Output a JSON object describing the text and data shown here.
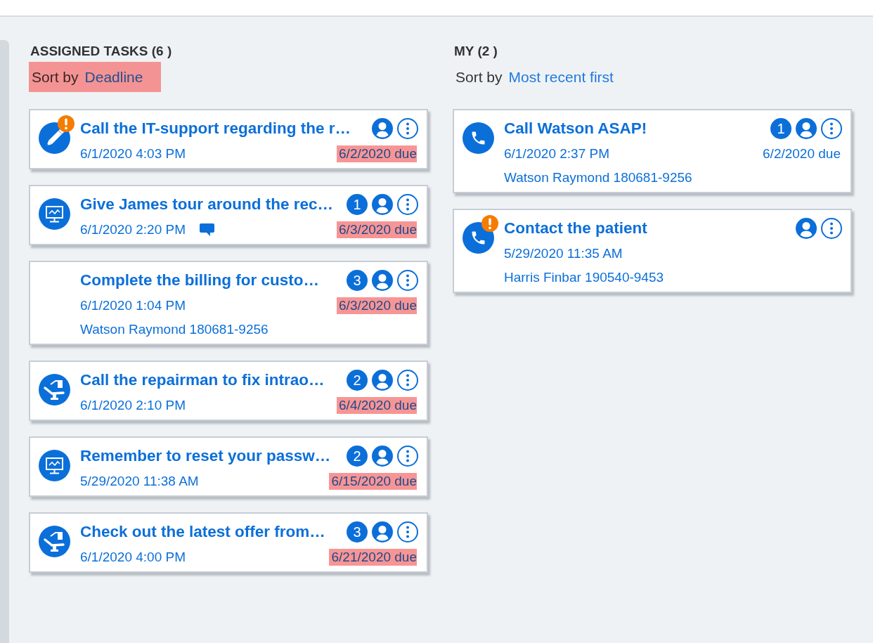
{
  "columns": [
    {
      "heading": "ASSIGNED TASKS (6 )",
      "sort": {
        "label": "Sort by",
        "value": "Deadline",
        "highlighted": true
      },
      "cards": [
        {
          "kind": "pencil",
          "alert": true,
          "title": "Call the IT-support regarding the r…",
          "created": "6/1/2020 4:03 PM",
          "comment": false,
          "due": {
            "text": "6/2/2020 due",
            "highlighted": true
          }
        },
        {
          "kind": "monitor",
          "alert": false,
          "title": "Give James tour around the rec…",
          "count": "1",
          "created": "6/1/2020 2:20 PM",
          "comment": true,
          "due": {
            "text": "6/3/2020 due",
            "highlighted": true
          }
        },
        {
          "kind": "blank",
          "alert": false,
          "title": "Complete the billing for custo…",
          "count": "3",
          "created": "6/1/2020 1:04 PM",
          "comment": false,
          "due": {
            "text": "6/3/2020 due",
            "highlighted": true
          },
          "contact": "Watson Raymond 180681-9256"
        },
        {
          "kind": "chair",
          "alert": false,
          "title": "Call the repairman to fix intrao…",
          "count": "2",
          "created": "6/1/2020 2:10 PM",
          "comment": false,
          "due": {
            "text": "6/4/2020 due",
            "highlighted": true
          }
        },
        {
          "kind": "monitor",
          "alert": false,
          "title": "Remember to reset your passw…",
          "count": "2",
          "created": "5/29/2020 11:38 AM",
          "comment": false,
          "due": {
            "text": "6/15/2020 due",
            "highlighted": true
          }
        },
        {
          "kind": "chair",
          "alert": false,
          "title": "Check out the latest offer from…",
          "count": "3",
          "created": "6/1/2020 4:00 PM",
          "comment": false,
          "due": {
            "text": "6/21/2020 due",
            "highlighted": true
          }
        }
      ]
    },
    {
      "heading": "MY (2 )",
      "sort": {
        "label": "Sort by",
        "value": "Most recent first",
        "highlighted": false
      },
      "cards": [
        {
          "kind": "phone",
          "alert": false,
          "title": "Call Watson ASAP!",
          "count": "1",
          "created": "6/1/2020 2:37 PM",
          "comment": false,
          "due": {
            "text": "6/2/2020 due",
            "highlighted": false
          },
          "contact": "Watson Raymond 180681-9256"
        },
        {
          "kind": "phone",
          "alert": true,
          "title": "Contact the patient",
          "created": "5/29/2020 11:35 AM",
          "comment": false,
          "contact": "Harris Finbar 190540-9453"
        }
      ]
    }
  ]
}
